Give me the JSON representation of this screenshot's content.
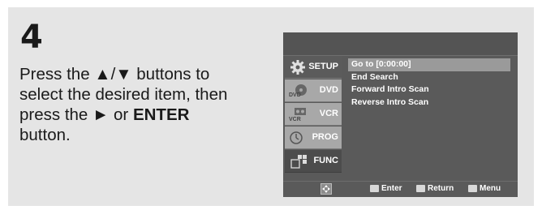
{
  "step": {
    "number": "4",
    "line1_a": "Press the ",
    "line1_arrows": "▲/▼",
    "line1_b": " buttons to",
    "line2": "select the desired item, then",
    "line3_a": "press the ",
    "line3_arrow": "►",
    "line3_b": " or ",
    "line3_enter": "ENTER",
    "line4": "button."
  },
  "menu": {
    "sidebar": [
      {
        "label": "SETUP",
        "icon": "gear-icon"
      },
      {
        "label": "DVD",
        "icon": "dvd-icon"
      },
      {
        "label": "VCR",
        "icon": "vcr-icon"
      },
      {
        "label": "PROG",
        "icon": "clock-icon"
      },
      {
        "label": "FUNC",
        "icon": "func-icon",
        "active": true
      }
    ],
    "items": [
      "Go to [0:00:00]",
      "End Search",
      "Forward Intro Scan",
      "Reverse Intro Scan"
    ],
    "selected_index": 0,
    "bottom": {
      "enter": "Enter",
      "return": "Return",
      "menu": "Menu"
    }
  }
}
